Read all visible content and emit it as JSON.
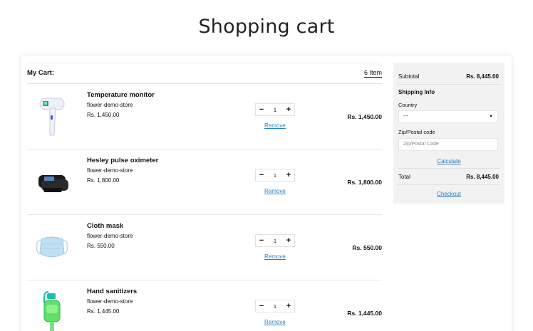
{
  "page": {
    "title": "Shopping cart"
  },
  "cart": {
    "label": "My Cart:",
    "count": "6 Item",
    "remove_label": "Remove",
    "items": [
      {
        "name": "Temperature monitor",
        "store": "flower-demo-store",
        "price": "Rs. 1,450.00",
        "qty": "1",
        "total": "Rs. 1,450.00",
        "icon": "thermometer-gun-icon"
      },
      {
        "name": "Hesley pulse oximeter",
        "store": "flower-demo-store",
        "price": "Rs. 1,800.00",
        "qty": "1",
        "total": "Rs. 1,800.00",
        "icon": "pulse-oximeter-icon"
      },
      {
        "name": "Cloth mask",
        "store": "flower-demo-store",
        "price": "Rs. 550.00",
        "qty": "1",
        "total": "Rs. 550.00",
        "icon": "face-mask-icon"
      },
      {
        "name": "Hand sanitizers",
        "store": "flower-demo-store",
        "price": "Rs. 1,445.00",
        "qty": "1",
        "total": "Rs. 1,445.00",
        "icon": "sanitizer-bottle-icon"
      }
    ]
  },
  "summary": {
    "subtotal_label": "Subtotal",
    "subtotal_value": "Rs. 8,445.00",
    "shipping_label": "Shipping Info",
    "country_label": "Country",
    "country_value": "---",
    "zip_label": "Zip/Postal code",
    "zip_placeholder": "Zip/Postal Code",
    "calculate_label": "Calculate",
    "total_label": "Total",
    "total_value": "Rs. 8,445.00",
    "checkout_label": "Checkout"
  },
  "colors": {
    "link": "#2a7fbf",
    "summary_bg": "#f2f2f2"
  }
}
